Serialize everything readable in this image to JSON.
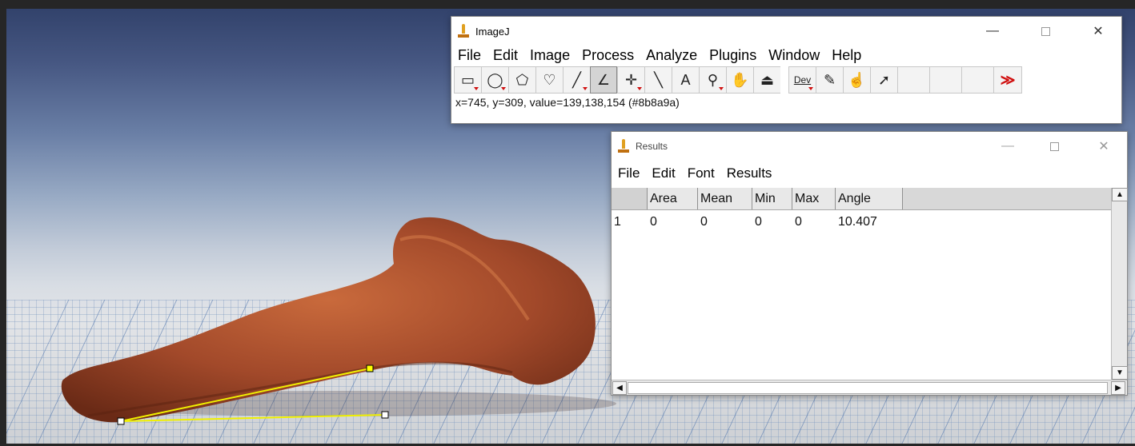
{
  "imagej": {
    "title": "ImageJ",
    "menu": [
      "File",
      "Edit",
      "Image",
      "Process",
      "Analyze",
      "Plugins",
      "Window",
      "Help"
    ],
    "tools": [
      {
        "icon": "rectangle-selection-icon",
        "glyph": "▭",
        "has_menu": true
      },
      {
        "icon": "oval-selection-icon",
        "glyph": "◯",
        "has_menu": true
      },
      {
        "icon": "polygon-selection-icon",
        "glyph": "⬠",
        "has_menu": false
      },
      {
        "icon": "freehand-selection-icon",
        "glyph": "♡",
        "has_menu": false
      },
      {
        "icon": "line-selection-icon",
        "glyph": "╱",
        "has_menu": true
      },
      {
        "icon": "angle-tool-icon",
        "glyph": "∠",
        "has_menu": false,
        "active": true
      },
      {
        "icon": "point-tool-icon",
        "glyph": "✛",
        "has_menu": true
      },
      {
        "icon": "wand-tool-icon",
        "glyph": "╲",
        "has_menu": false
      },
      {
        "icon": "text-tool-icon",
        "glyph": "A",
        "has_menu": false
      },
      {
        "icon": "magnifying-glass-icon",
        "glyph": "⚲",
        "has_menu": true
      },
      {
        "icon": "scrolling-hand-icon",
        "glyph": "✋",
        "has_menu": false
      },
      {
        "icon": "color-picker-icon",
        "glyph": "⏏",
        "has_menu": false
      },
      {
        "icon": "dev-menu-icon",
        "glyph": "Dev",
        "has_menu": true,
        "gap": true
      },
      {
        "icon": "paintbrush-icon",
        "glyph": "✎",
        "has_menu": false
      },
      {
        "icon": "flood-fill-icon",
        "glyph": "☝",
        "has_menu": false
      },
      {
        "icon": "pencil-arrow-icon",
        "glyph": "➚",
        "has_menu": false
      },
      {
        "icon": "empty-slot-icon",
        "glyph": "",
        "has_menu": false,
        "blank": true
      },
      {
        "icon": "empty-slot-icon",
        "glyph": "",
        "has_menu": false,
        "blank": true
      },
      {
        "icon": "empty-slot-icon",
        "glyph": "",
        "has_menu": false,
        "blank": true
      },
      {
        "icon": "more-tools-icon",
        "glyph": "≫",
        "has_menu": false,
        "more": true
      }
    ],
    "status": "x=745, y=309, value=139,138,154 (#8b8a9a)"
  },
  "results": {
    "title": "Results",
    "menu": [
      "File",
      "Edit",
      "Font",
      "Results"
    ],
    "columns": [
      "",
      "Area",
      "Mean",
      "Min",
      "Max",
      "Angle"
    ],
    "rows": [
      [
        "1",
        "0",
        "0",
        "0",
        "0",
        "10.407"
      ]
    ]
  },
  "window_controls": {
    "minimize": "—",
    "close": "✕"
  },
  "colors": {
    "angle_line": "#f0f000",
    "handle_fill": "#ffff00",
    "handle_white": "#ffffff"
  }
}
